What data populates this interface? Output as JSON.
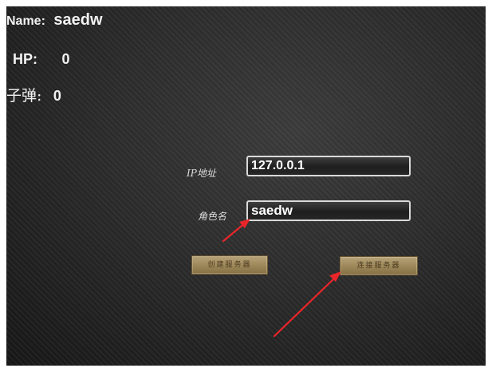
{
  "hud": {
    "name_label": "Name:",
    "name_value": "saedw",
    "hp_label": "HP:",
    "hp_value": "0",
    "ammo_label": "子弹:",
    "ammo_value": "0"
  },
  "login": {
    "ip_label": "IP地址",
    "ip_value": "127.0.0.1",
    "role_label": "角色名",
    "role_value": "saedw",
    "create_server_button": "创建服务器",
    "connect_server_button": "连接服务器"
  },
  "annotations": {
    "arrow_color": "#e8262a"
  }
}
